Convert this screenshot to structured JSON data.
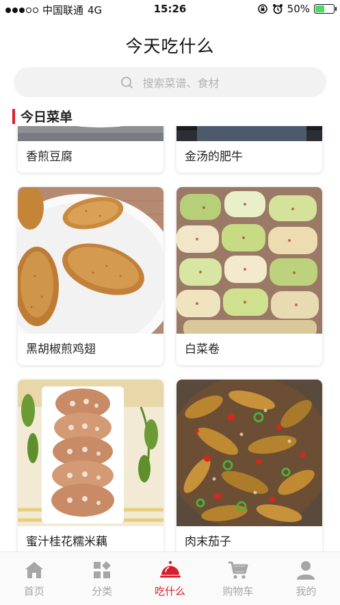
{
  "status_bar": {
    "carrier": "中国联通",
    "network": "4G",
    "time": "15:26",
    "battery_percent": "50%",
    "battery_level": 0.5,
    "colors": {
      "battery": "#4cd964"
    }
  },
  "header": {
    "title": "今天吃什么"
  },
  "search": {
    "placeholder": "搜索菜谱、食材",
    "icon": "search-icon"
  },
  "section": {
    "title": "今日菜单",
    "accent": "#e01e2b"
  },
  "recipes": [
    {
      "name": "香煎豆腐"
    },
    {
      "name": "金汤的肥牛"
    },
    {
      "name": "黑胡椒煎鸡翅"
    },
    {
      "name": "白菜卷"
    },
    {
      "name": "蜜汁桂花糯米藕"
    },
    {
      "name": "肉末茄子"
    }
  ],
  "tab_bar": {
    "active_color": "#d81e2c",
    "tabs": [
      {
        "label": "首页",
        "icon": "home-icon"
      },
      {
        "label": "分类",
        "icon": "category-icon"
      },
      {
        "label": "吃什么",
        "icon": "cloche-icon",
        "active": true
      },
      {
        "label": "购物车",
        "icon": "cart-icon"
      },
      {
        "label": "我的",
        "icon": "user-icon"
      }
    ]
  }
}
